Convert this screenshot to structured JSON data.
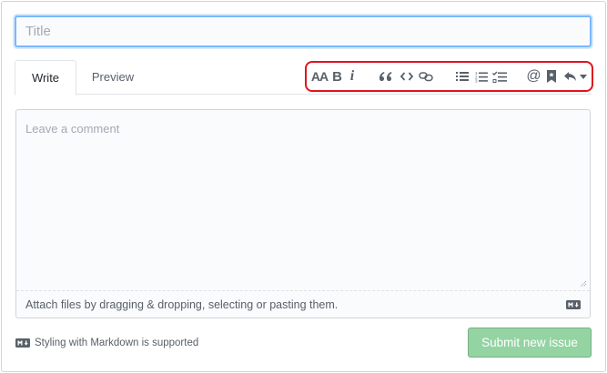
{
  "title_field": {
    "value": "",
    "placeholder": "Title"
  },
  "tabs": {
    "write": "Write",
    "preview": "Preview"
  },
  "toolbar": {
    "header_label": "AA",
    "bold_label": "B",
    "italic_label": "i",
    "mention_label": "@",
    "icons": [
      "text-size-icon",
      "bold-icon",
      "italic-icon",
      "quote-icon",
      "code-icon",
      "link-icon",
      "unordered-list-icon",
      "ordered-list-icon",
      "task-list-icon",
      "mention-icon",
      "bookmark-icon",
      "reply-icon",
      "caret-down-icon"
    ]
  },
  "comment": {
    "placeholder": "Leave a comment",
    "attach_text": "Attach files by dragging & dropping, selecting or pasting them."
  },
  "footer": {
    "markdown_note": "Styling with Markdown is supported",
    "submit_label": "Submit new issue"
  },
  "colors": {
    "focus_border": "#79b8ff",
    "highlight_red": "#e0141e",
    "submit_disabled_green": "#94d3a2",
    "icon_gray": "#586069"
  }
}
